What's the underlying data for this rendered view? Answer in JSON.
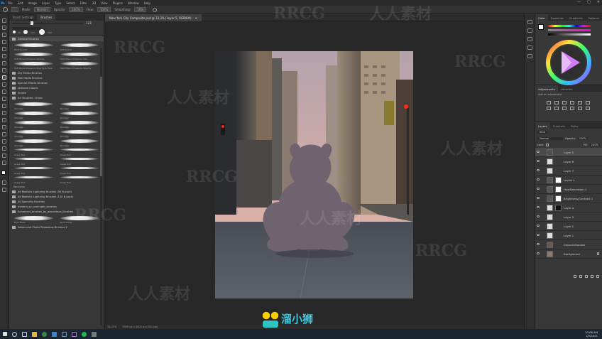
{
  "menubar": {
    "app_logo": "Ps",
    "items": [
      "File",
      "Edit",
      "Image",
      "Layer",
      "Type",
      "Select",
      "Filter",
      "3D",
      "View",
      "Plugins",
      "Window",
      "Help"
    ],
    "window_controls": [
      "—",
      "□",
      "✕"
    ]
  },
  "optionsbar": {
    "mode_label": "Mode:",
    "mode_value": "Normal",
    "opacity_label": "Opacity:",
    "opacity_value": "100%",
    "flow_label": "Flow:",
    "flow_value": "100%",
    "smoothing_label": "Smoothing:",
    "smoothing_value": "10%"
  },
  "document": {
    "tab_title": "New York City Composite.psd @ 33.3% (Layer 5, RGB/8#)",
    "close_glyph": "✕"
  },
  "status": {
    "zoom": "33.33%",
    "info": "3000 px x 4000 px (300 ppi)"
  },
  "left_panel": {
    "tabs": [
      "Brush Settings",
      "Brushes"
    ],
    "brush_size": "123",
    "brush_sizes": [
      "30",
      "123",
      "700"
    ],
    "folders": [
      {
        "label": "General Brushes",
        "sel": true
      },
      {
        "label": "Dry Media Brushes",
        "sel": false
      },
      {
        "label": "Wet Media Brushes",
        "sel": false
      },
      {
        "label": "Special Effects Brushes",
        "sel": false
      },
      {
        "label": "Jawbone Clouds",
        "sel": false
      },
      {
        "label": "Smoke",
        "sel": false
      },
      {
        "label": "Art Brushes - Grass",
        "sel": false
      }
    ],
    "brushes_a": [
      "Hard Round",
      "Soft Round",
      "Soft Round Pressure Opacity",
      "Hard Round Pressure Size",
      "Soft Round Pressure Opacity & Flow",
      "Hard Round Pressure Opacity"
    ],
    "brushes_b": [
      "Smudge",
      "Smudge",
      "Smudge",
      "Smudge",
      "Smudge",
      "Smudge",
      "Smudge",
      "Smudge",
      "Smudge",
      "Smudge",
      "Grass Tool",
      "Grass Tool",
      "Grass Tool",
      "Grass Tool",
      "Grass Tool",
      "Grass Tool",
      "Grass Tool",
      "Grass Tool"
    ],
    "lower_header": "Hardness",
    "lower_folders": [
      "All Realistic Lightning Brushes (30 B-pack)",
      "All Realistic Lightning Brushes (100 B-pack)",
      "All Specialty Brushes",
      "modern_sv_overnight_brushes",
      "Enhanced_brushes_by_ozonedeux_Brushes"
    ],
    "bottom_brushes": [
      "Rock Bush",
      "Rock Guide"
    ],
    "bottom_folder": "Watercolor Photo Photoshop Brushes 2"
  },
  "right_panels": {
    "color_tabs": [
      "Color",
      "Swatches",
      "Gradients",
      "Patterns"
    ],
    "adjust_tabs": [
      "Adjustments",
      "Libraries"
    ],
    "adjust_hint": "Add an adjustment",
    "layer_tabs": [
      "Layers",
      "Channels",
      "Paths"
    ],
    "kind_label": "Kind",
    "blend_label": "Normal",
    "opacity_label": "Opacity:",
    "opacity_value": "100%",
    "lock_label": "Lock:",
    "fill_label": "Fill:",
    "fill_value": "100%",
    "layers": [
      {
        "name": "Layer 5",
        "sel": true
      },
      {
        "name": "Layer 6",
        "sel": false
      },
      {
        "name": "Layer 7",
        "sel": false
      },
      {
        "name": "Levels 1",
        "sel": false
      },
      {
        "name": "Hue/Saturation 1",
        "sel": false
      },
      {
        "name": "Brightness/Contrast 1",
        "sel": false
      },
      {
        "name": "Layer 4",
        "sel": false
      },
      {
        "name": "Layer 3",
        "sel": false
      },
      {
        "name": "Layer 2",
        "sel": false
      },
      {
        "name": "Layer 1",
        "sel": false
      },
      {
        "name": "Ground Shadow",
        "sel": false
      },
      {
        "name": "Background",
        "sel": false
      }
    ]
  },
  "taskbar": {
    "time": "10:06 AM",
    "date": "1/5/2021"
  },
  "watermarks": [
    "RRCG",
    "人人素材"
  ],
  "logo_text": "溜小狮",
  "colors": {
    "accent": "#31a8ff",
    "canvas_bg": "#282828",
    "panel_bg": "#383838",
    "silhouette": "#6f6370"
  }
}
